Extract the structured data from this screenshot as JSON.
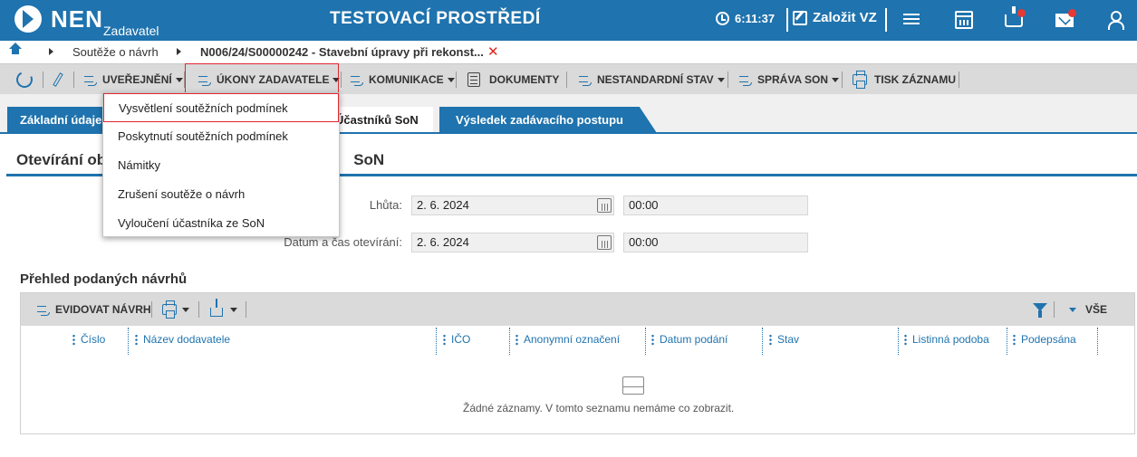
{
  "header": {
    "logo_text": "NEN",
    "logo_sub": "Zadavatel",
    "environment_title": "TESTOVACÍ PROSTŘEDÍ",
    "clock": "6:11:37",
    "create_label": "Založit VZ",
    "accent_color": "#1f73ae"
  },
  "breadcrumb": {
    "items": [
      "Soutěže o návrh",
      "N006/24/S00000242 - Stavební úpravy při rekonst..."
    ]
  },
  "toolbar": {
    "items": [
      "UVEŘEJNĚNÍ",
      "ÚKONY ZADAVATELE",
      "KOMUNIKACE",
      "DOKUMENTY",
      "NESTANDARDNÍ STAV",
      "SPRÁVA SON",
      "TISK ZÁZNAMU"
    ]
  },
  "dropdown": {
    "items": [
      "Vysvětlení soutěžních podmínek",
      "Poskytnutí soutěžních podmínek",
      "Námitky",
      "Zrušení soutěže o návrh",
      "Vyloučení účastníka ze SoN"
    ]
  },
  "tabs": [
    "Základní údaje",
    "Účastníků SoN",
    "Výsledek zadávacího postupu"
  ],
  "section": {
    "title_left": "Otevírání ob",
    "title_right": "SoN",
    "fields": [
      {
        "label": "Lhůta:",
        "date": "2. 6. 2024",
        "time": "00:00"
      },
      {
        "label": "Datum a čas otevírání:",
        "date": "2. 6. 2024",
        "time": "00:00"
      }
    ]
  },
  "overview": {
    "title": "Přehled podaných návrhů",
    "register_label": "EVIDOVAT NÁVRH",
    "all_label": "VŠE",
    "columns": [
      "Číslo",
      "Název dodavatele",
      "IČO",
      "Anonymní označení",
      "Datum podání",
      "Stav",
      "Listinná podoba",
      "Podepsána"
    ],
    "empty_text": "Žádné záznamy. V tomto seznamu nemáme co zobrazit."
  }
}
